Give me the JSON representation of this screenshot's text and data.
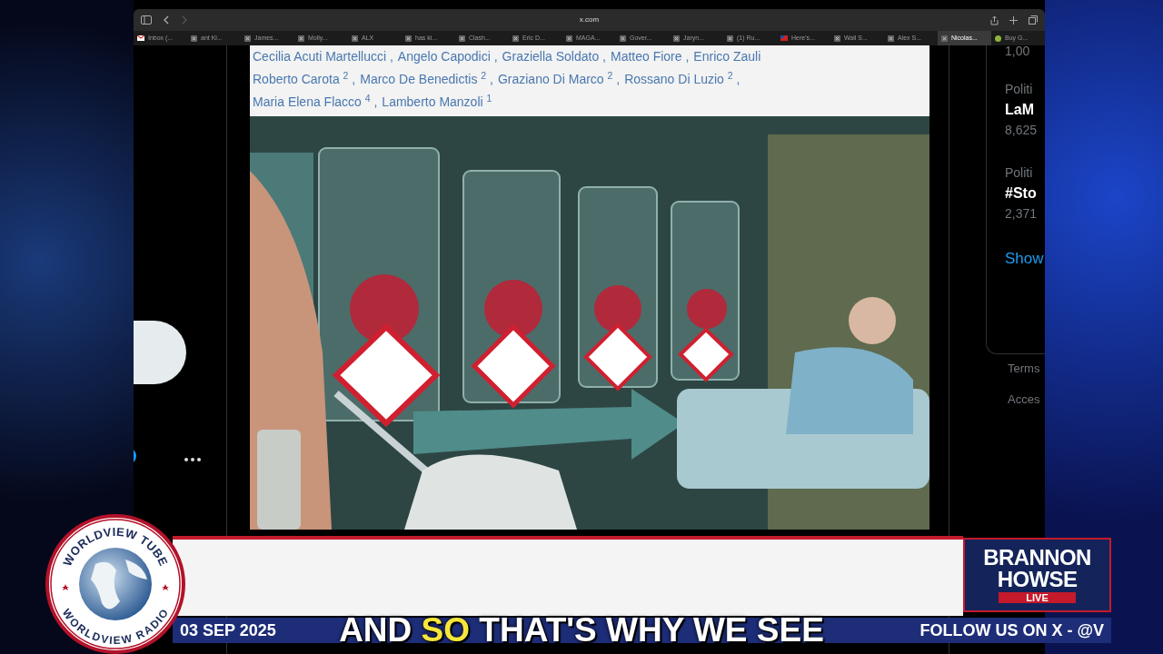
{
  "browser": {
    "address": "x.com",
    "tabs": [
      {
        "label": "Inbox (...",
        "kind": "mail",
        "selected": false
      },
      {
        "label": "ant Ki...",
        "kind": "x",
        "selected": false
      },
      {
        "label": "James...",
        "kind": "x",
        "selected": false
      },
      {
        "label": "Molly...",
        "kind": "x",
        "selected": false
      },
      {
        "label": "ALX",
        "kind": "x",
        "selected": false
      },
      {
        "label": "has ki...",
        "kind": "x",
        "selected": false
      },
      {
        "label": "Clash...",
        "kind": "x",
        "selected": false
      },
      {
        "label": "Eric D...",
        "kind": "x",
        "selected": false
      },
      {
        "label": "MAGA...",
        "kind": "x",
        "selected": false
      },
      {
        "label": "Gover...",
        "kind": "x",
        "selected": false
      },
      {
        "label": "Jaryn...",
        "kind": "x",
        "selected": false
      },
      {
        "label": "(1) Ru...",
        "kind": "x",
        "selected": false
      },
      {
        "label": "Here's...",
        "kind": "flag",
        "selected": false
      },
      {
        "label": "Wall S...",
        "kind": "x",
        "selected": false
      },
      {
        "label": "Alex S...",
        "kind": "x",
        "selected": false
      },
      {
        "label": "Nicolas...",
        "kind": "x",
        "selected": true
      },
      {
        "label": "Buy G...",
        "kind": "coin",
        "selected": false
      }
    ]
  },
  "article": {
    "authors": [
      [
        "Cecilia Acuti Martellucci ,",
        "Angelo Capodici ,",
        "Graziella Soldato ,",
        "Matteo Fiore ,",
        "Enrico Zauli"
      ],
      [
        "Roberto Carota $^{2}$ ,",
        "Marco De Benedictis $^{2}$ ,",
        "Graziano Di Marco $^{2}$ ,",
        "Rossano Di Luzio $^{2}$ ,"
      ],
      [
        "Maria Elena Flacco $^{4}$ ,",
        "Lamberto Manzoli $^{1}$"
      ]
    ]
  },
  "trends": {
    "count": "1,00",
    "items": [
      {
        "category": "Politi",
        "topic": "LaM",
        "posts": "8,625"
      },
      {
        "category": "Politi",
        "topic": "#Sto",
        "posts": "2,371"
      }
    ],
    "show_more": "Show"
  },
  "footer_links": [
    "Terms",
    "Acces"
  ],
  "broadcast": {
    "logo": {
      "top": "WORLDVIEW TUBE",
      "bottom": "WORLDVIEW RADIO"
    },
    "brand": [
      "BRANNON",
      "HOWSE"
    ],
    "live": "LIVE",
    "ticker": {
      "date": "03 SEP 2025",
      "follow": "FOLLOW US ON X - @V"
    },
    "caption": [
      {
        "text": "AND",
        "highlighted": false
      },
      {
        "text": "SO",
        "highlighted": true
      },
      {
        "text": "THAT'S WHY WE SEE",
        "highlighted": false
      }
    ]
  }
}
